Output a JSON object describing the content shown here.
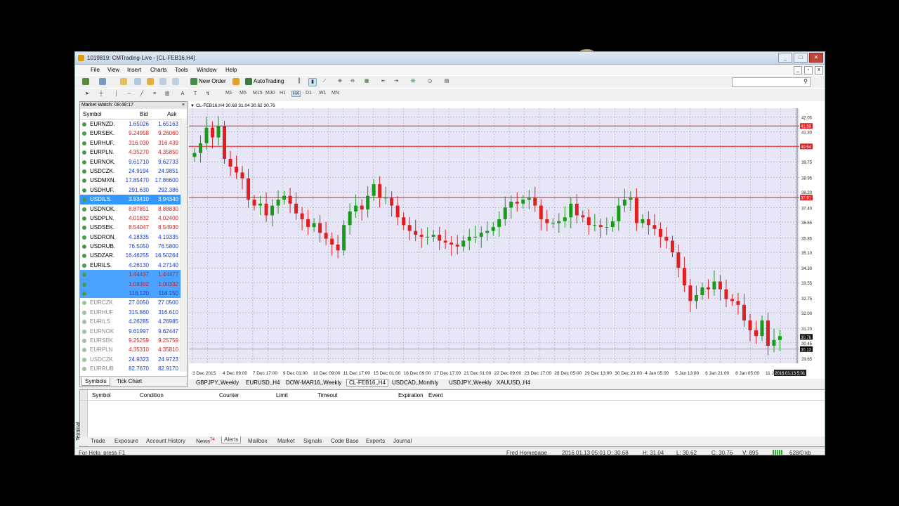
{
  "window": {
    "title": "1019819: CMTrading-Live - [CL-FEB16,H4]"
  },
  "menu": [
    "File",
    "View",
    "Insert",
    "Charts",
    "Tools",
    "Window",
    "Help"
  ],
  "toolbar": {
    "new_order": "New Order",
    "autotrading": "AutoTrading",
    "timeframes": [
      "M1",
      "M5",
      "M15",
      "M30",
      "H1",
      "H4",
      "D1",
      "W1",
      "MN"
    ],
    "active_timeframe": "H4"
  },
  "market_watch": {
    "header": "Market Watch: 08:48:17",
    "col_symbol": "Symbol",
    "col_bid": "Bid",
    "col_ask": "Ask",
    "rows": [
      {
        "symbol": "EURNZD.",
        "bid": "1.65026",
        "ask": "1.65163",
        "state": "up"
      },
      {
        "symbol": "EURSEK.",
        "bid": "9.24958",
        "ask": "9.26060",
        "state": "down"
      },
      {
        "symbol": "EURHUF.",
        "bid": "316.030",
        "ask": "316.439",
        "state": "down"
      },
      {
        "symbol": "EURPLN.",
        "bid": "4.35270",
        "ask": "4.35850",
        "state": "down"
      },
      {
        "symbol": "EURNOK.",
        "bid": "9.61710",
        "ask": "9.62733",
        "state": "up"
      },
      {
        "symbol": "USDCZK.",
        "bid": "24.9194",
        "ask": "24.9851",
        "state": "up"
      },
      {
        "symbol": "USDMXN.",
        "bid": "17.85470",
        "ask": "17.86600",
        "state": "up"
      },
      {
        "symbol": "USDHUF.",
        "bid": "291.630",
        "ask": "292.386",
        "state": "up"
      },
      {
        "symbol": "USDILS.",
        "bid": "3.93410",
        "ask": "3.94340",
        "state": "selected"
      },
      {
        "symbol": "USDNOK.",
        "bid": "8.87851",
        "ask": "8.88830",
        "state": "down"
      },
      {
        "symbol": "USDPLN.",
        "bid": "4.01832",
        "ask": "4.02400",
        "state": "down"
      },
      {
        "symbol": "USDSEK.",
        "bid": "8.54047",
        "ask": "8.54930",
        "state": "down"
      },
      {
        "symbol": "USDRON.",
        "bid": "4.18335",
        "ask": "4.19335",
        "state": "up"
      },
      {
        "symbol": "USDRUB.",
        "bid": "76.5050",
        "ask": "76.5800",
        "state": "up"
      },
      {
        "symbol": "USDZAR.",
        "bid": "16.46255",
        "ask": "16.50264",
        "state": "up"
      },
      {
        "symbol": "EURILS.",
        "bid": "4.26130",
        "ask": "4.27140",
        "state": "up"
      },
      {
        "symbol": "",
        "bid": "1.44437",
        "ask": "1.44477",
        "state": "hl-down"
      },
      {
        "symbol": "",
        "bid": "1.08302",
        "ask": "1.08332",
        "state": "hl-down"
      },
      {
        "symbol": "",
        "bid": "118.120",
        "ask": "118.150",
        "state": "hl-up"
      },
      {
        "symbol": "EURCZK",
        "bid": "27.0050",
        "ask": "27.0500",
        "state": "grey"
      },
      {
        "symbol": "EURHUF",
        "bid": "315.860",
        "ask": "316.610",
        "state": "grey"
      },
      {
        "symbol": "EURILS",
        "bid": "4.26285",
        "ask": "4.26985",
        "state": "grey"
      },
      {
        "symbol": "EURNOK",
        "bid": "9.61997",
        "ask": "9.62447",
        "state": "grey"
      },
      {
        "symbol": "EURSEK",
        "bid": "9.25259",
        "ask": "9.25759",
        "state": "grey-red"
      },
      {
        "symbol": "EURPLN",
        "bid": "4.35310",
        "ask": "4.35810",
        "state": "grey-red"
      },
      {
        "symbol": "USDCZK",
        "bid": "24.9323",
        "ask": "24.9723",
        "state": "grey"
      },
      {
        "symbol": "EURRUB",
        "bid": "82.7670",
        "ask": "82.9170",
        "state": "grey"
      }
    ],
    "tabs": [
      "Symbols",
      "Tick Chart"
    ]
  },
  "chart_data": {
    "type": "candlestick",
    "title": "CL-FEB16,H4  30.68 31.04 30.62 30.76",
    "yticks": [
      "42.05",
      "41.30",
      "40.50",
      "39.75",
      "38.95",
      "38.20",
      "37.40",
      "36.65",
      "35.85",
      "35.10",
      "34.30",
      "33.55",
      "32.75",
      "32.00",
      "31.20",
      "30.45",
      "29.65"
    ],
    "ylim": [
      29.4,
      42.5
    ],
    "xticks": [
      "3 Dec 2015",
      "4 Dec 09:00",
      "7 Dec 17:00",
      "9 Dec 01:00",
      "10 Dec 09:00",
      "11 Dec 17:00",
      "15 Dec 01:00",
      "16 Dec 09:00",
      "17 Dec 17:00",
      "21 Dec 01:00",
      "22 Dec 09:00",
      "23 Dec 17:00",
      "28 Dec 05:00",
      "29 Dec 13:00",
      "30 Dec 21:00",
      "4 Jan 05:00",
      "5 Jan 13:00",
      "6 Jan 21:00",
      "8 Jan 05:00",
      "11 Jan 13:00"
    ],
    "hlines": [
      41.59,
      40.54,
      37.91
    ],
    "hline_labels": [
      "41.59",
      "40.54",
      "37.91"
    ],
    "current_price": "30.76",
    "bid_line": "30.13",
    "last_time_label": "2016.01.13 5:01",
    "closes": [
      40.2,
      40.7,
      41.5,
      41.0,
      41.6,
      39.9,
      39.5,
      39.2,
      38.9,
      37.8,
      37.5,
      37.6,
      37.0,
      37.5,
      37.8,
      38.0,
      37.6,
      37.1,
      36.8,
      36.4,
      36.6,
      36.1,
      35.8,
      35.5,
      35.2,
      36.5,
      37.2,
      37.5,
      37.3,
      38.0,
      38.6,
      37.9,
      37.9,
      37.5,
      36.9,
      36.5,
      36.2,
      36.0,
      35.9,
      35.9,
      36.0,
      35.7,
      35.6,
      35.5,
      35.4,
      35.7,
      35.9,
      35.9,
      36.1,
      36.2,
      36.4,
      36.8,
      37.4,
      37.7,
      37.6,
      37.8,
      37.9,
      37.5,
      36.8,
      36.6,
      36.6,
      36.7,
      36.9,
      37.6,
      37.0,
      36.9,
      36.5,
      36.5,
      36.4,
      36.4,
      36.7,
      37.5,
      37.8,
      37.9,
      36.6,
      36.8,
      36.5,
      36.3,
      35.9,
      35.7,
      35.1,
      34.3,
      33.4,
      32.6,
      32.9,
      33.3,
      33.2,
      33.6,
      33.2,
      32.7,
      32.6,
      32.4,
      31.6,
      31.1,
      30.8,
      31.6,
      30.3,
      30.6,
      30.8
    ]
  },
  "chart_tabs": [
    "GBPJPY,,Weekly",
    "EURUSD,,H4",
    "DOW-MAR16,,Weekly",
    "CL-FEB16,,H4",
    "USDCAD,,Monthly",
    "USDJPY,,Weekly",
    "XAUUSD,,H4"
  ],
  "active_chart_tab": 3,
  "terminal": {
    "cols": [
      "Symbol",
      "Condition",
      "Counter",
      "Limit",
      "Timeout",
      "Expiration",
      "Event"
    ],
    "side_label": "Terminal",
    "tabs": [
      "Trade",
      "Exposure",
      "Account History",
      "News",
      "Alerts",
      "Mailbox",
      "Market",
      "Signals",
      "Code Base",
      "Experts",
      "Journal"
    ],
    "news_badge": "74",
    "active_tab": "Alerts"
  },
  "status": {
    "help": "For Help, press F1",
    "profile": "Fred Homepage",
    "time": "2016.01.13 05:01",
    "open": "O: 30.68",
    "high": "H: 31.04",
    "low": "L: 30.62",
    "close": "C: 30.76",
    "volume": "V: 895",
    "traffic": "628/0 kb"
  },
  "colors": {
    "chart_bg": "#e6e6f7",
    "bull": "#1a9a1a",
    "bear": "#e02020",
    "hline": "#e02020",
    "selected_row": "#3399ff"
  }
}
